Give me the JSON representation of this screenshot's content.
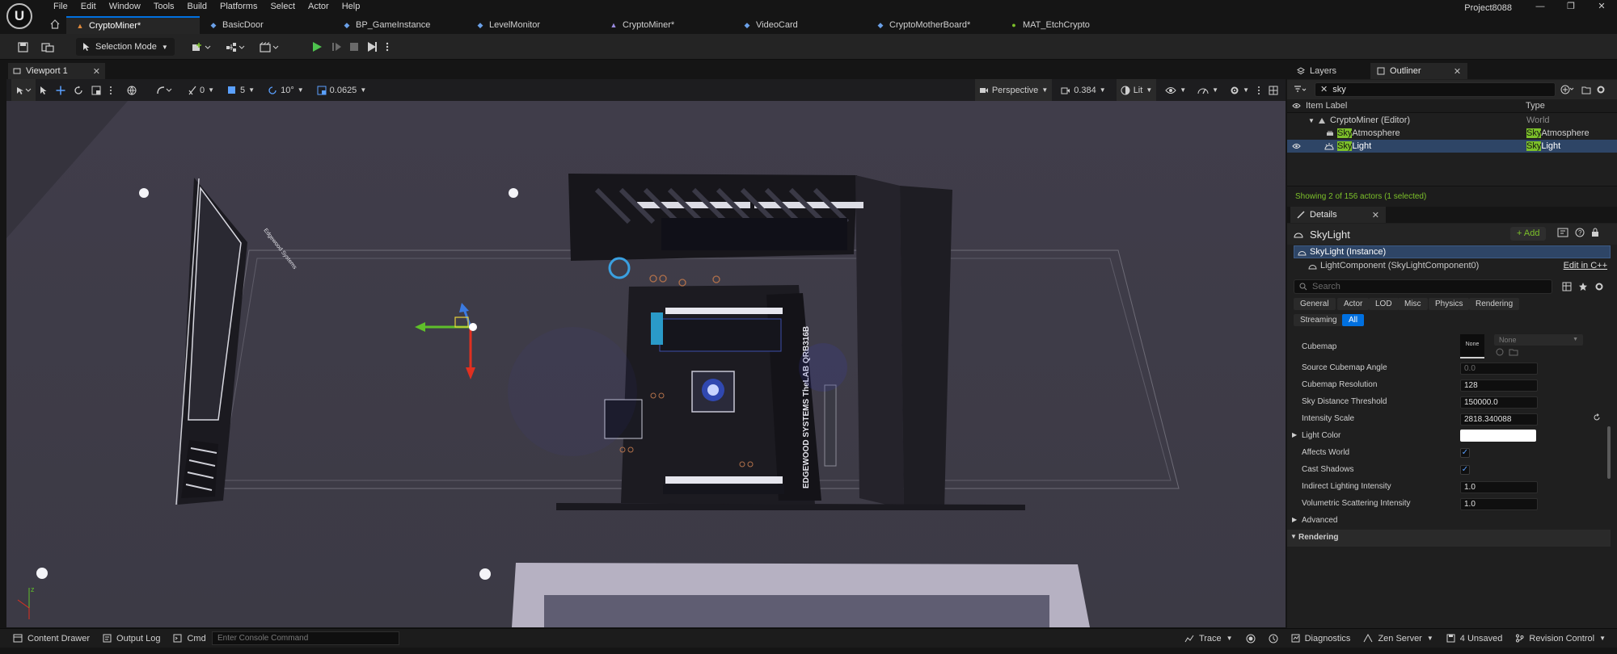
{
  "app": {
    "logo_letter": "U",
    "project_name": "Project8088",
    "window_controls": [
      "—",
      "❐",
      "✕"
    ]
  },
  "menu": [
    "File",
    "Edit",
    "Window",
    "Tools",
    "Build",
    "Platforms",
    "Select",
    "Actor",
    "Help"
  ],
  "tabs": [
    {
      "label": "CryptoMiner*",
      "icon": "level-icon",
      "active": true
    },
    {
      "label": "BasicDoor",
      "icon": "blueprint-icon",
      "active": false
    },
    {
      "label": "BP_GameInstance",
      "icon": "blueprint-icon",
      "active": false
    },
    {
      "label": "LevelMonitor",
      "icon": "blueprint-icon",
      "active": false
    },
    {
      "label": "CryptoMiner*",
      "icon": "level-icon",
      "active": false
    },
    {
      "label": "VideoCard",
      "icon": "blueprint-icon",
      "active": false
    },
    {
      "label": "CryptoMotherBoard*",
      "icon": "blueprint-icon",
      "active": false
    },
    {
      "label": "MAT_EtchCrypto",
      "icon": "material-icon",
      "active": false
    }
  ],
  "toolbar": {
    "selection_mode": "Selection Mode"
  },
  "viewport": {
    "tab_label": "Viewport 1",
    "snap_rotation_count": "0",
    "snap_scale_count": "5",
    "angle_snap": "10°",
    "grid_snap": "0.0625",
    "view_mode": "Perspective",
    "camera_speed": "0.384",
    "lighting": "Lit",
    "board_label": "EDGEWOOD SYSTEMS TheLAB QRB316B",
    "door_label": "Edgewood Systems"
  },
  "statusbar": {
    "content_drawer": "Content Drawer",
    "output_log": "Output Log",
    "cmd": "Cmd",
    "console_placeholder": "Enter Console Command",
    "trace": "Trace",
    "diagnostics": "Diagnostics",
    "zen_server": "Zen Server",
    "unsaved": "4 Unsaved",
    "revision_control": "Revision Control"
  },
  "outliner": {
    "tab_layers": "Layers",
    "tab_outliner": "Outliner",
    "search_value": "sky",
    "col_item_label": "Item Label",
    "col_type": "Type",
    "rows": [
      {
        "label_pre": "",
        "label_hl": "",
        "label_post": "CryptoMiner (Editor)",
        "type_hl": "",
        "type_post": "World",
        "depth": 1,
        "selected": false
      },
      {
        "label_pre": "",
        "label_hl": "Sky",
        "label_post": "Atmosphere",
        "type_hl": "Sky",
        "type_post": "Atmosphere",
        "depth": 2,
        "selected": false
      },
      {
        "label_pre": "",
        "label_hl": "Sky",
        "label_post": "Light",
        "type_hl": "Sky",
        "type_post": "Light",
        "depth": 2,
        "selected": true
      }
    ],
    "footer": "Showing 2 of 156 actors (1 selected)"
  },
  "details": {
    "tab_label": "Details",
    "actor_name": "SkyLight",
    "add_label": "+ Add",
    "instance_label": "SkyLight (Instance)",
    "component_label": "LightComponent (SkyLightComponent0)",
    "edit_cpp": "Edit in C++",
    "search_placeholder": "Search",
    "categories": [
      "General",
      "Actor",
      "LOD",
      "Misc",
      "Physics",
      "Rendering",
      "Streaming",
      "All"
    ],
    "active_category": "All",
    "cubemap_label": "Cubemap",
    "cubemap_thumb": "None",
    "cubemap_value": "None",
    "properties": [
      {
        "label": "Source Cubemap Angle",
        "value": "0.0",
        "kind": "text",
        "dim": true
      },
      {
        "label": "Cubemap Resolution",
        "value": "128",
        "kind": "text",
        "dim": false
      },
      {
        "label": "Sky Distance Threshold",
        "value": "150000.0",
        "kind": "text",
        "dim": false
      },
      {
        "label": "Intensity Scale",
        "value": "2818.340088",
        "kind": "text",
        "dim": false
      },
      {
        "label": "Light Color",
        "value": "",
        "kind": "color",
        "dim": false
      },
      {
        "label": "Affects World",
        "value": "✓",
        "kind": "check",
        "dim": false
      },
      {
        "label": "Cast Shadows",
        "value": "✓",
        "kind": "check",
        "dim": false
      },
      {
        "label": "Indirect Lighting Intensity",
        "value": "1.0",
        "kind": "text",
        "dim": false
      },
      {
        "label": "Volumetric Scattering Intensity",
        "value": "1.0",
        "kind": "text",
        "dim": false
      }
    ],
    "section_advanced": "Advanced",
    "section_rendering": "Rendering"
  },
  "colors": {
    "accent": "#0070e0",
    "play_green": "#4ec34e",
    "highlight": "#7cc02a",
    "selected_row": "#2e4566"
  }
}
